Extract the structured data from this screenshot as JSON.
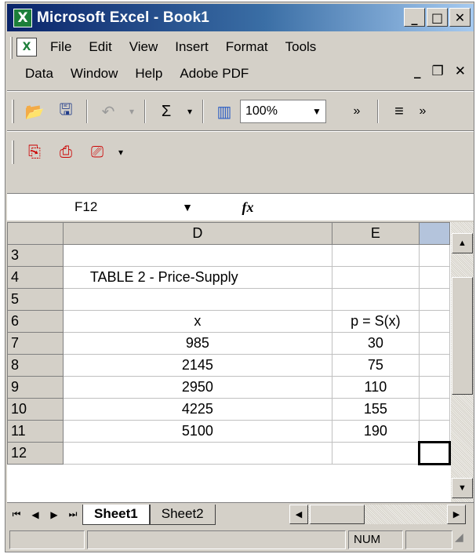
{
  "window": {
    "title": "Microsoft Excel - Book1",
    "app_icon": "excel-icon"
  },
  "menu": {
    "items": [
      {
        "label": "File"
      },
      {
        "label": "Edit"
      },
      {
        "label": "View"
      },
      {
        "label": "Insert"
      },
      {
        "label": "Format"
      },
      {
        "label": "Tools"
      },
      {
        "label": "Data"
      },
      {
        "label": "Window"
      },
      {
        "label": "Help"
      },
      {
        "label": "Adobe PDF"
      }
    ]
  },
  "toolbar": {
    "zoom": "100%"
  },
  "formula_bar": {
    "name_box": "F12",
    "fx_label": "fx",
    "formula": ""
  },
  "grid": {
    "columns": [
      "D",
      "E"
    ],
    "rows": [
      {
        "num": "3",
        "d": "",
        "e": ""
      },
      {
        "num": "4",
        "d": "TABLE 2 - Price-Supply",
        "e": ""
      },
      {
        "num": "5",
        "d": "",
        "e": ""
      },
      {
        "num": "6",
        "d": "x",
        "e": "p = S(x)"
      },
      {
        "num": "7",
        "d": "985",
        "e": "30"
      },
      {
        "num": "8",
        "d": "2145",
        "e": "75"
      },
      {
        "num": "9",
        "d": "2950",
        "e": "110"
      },
      {
        "num": "10",
        "d": "4225",
        "e": "155"
      },
      {
        "num": "11",
        "d": "5100",
        "e": "190"
      },
      {
        "num": "12",
        "d": "",
        "e": ""
      }
    ]
  },
  "sheets": {
    "tabs": [
      {
        "label": "Sheet1"
      },
      {
        "label": "Sheet2"
      }
    ],
    "active": "Sheet1"
  },
  "status": {
    "num_indicator": "NUM"
  }
}
